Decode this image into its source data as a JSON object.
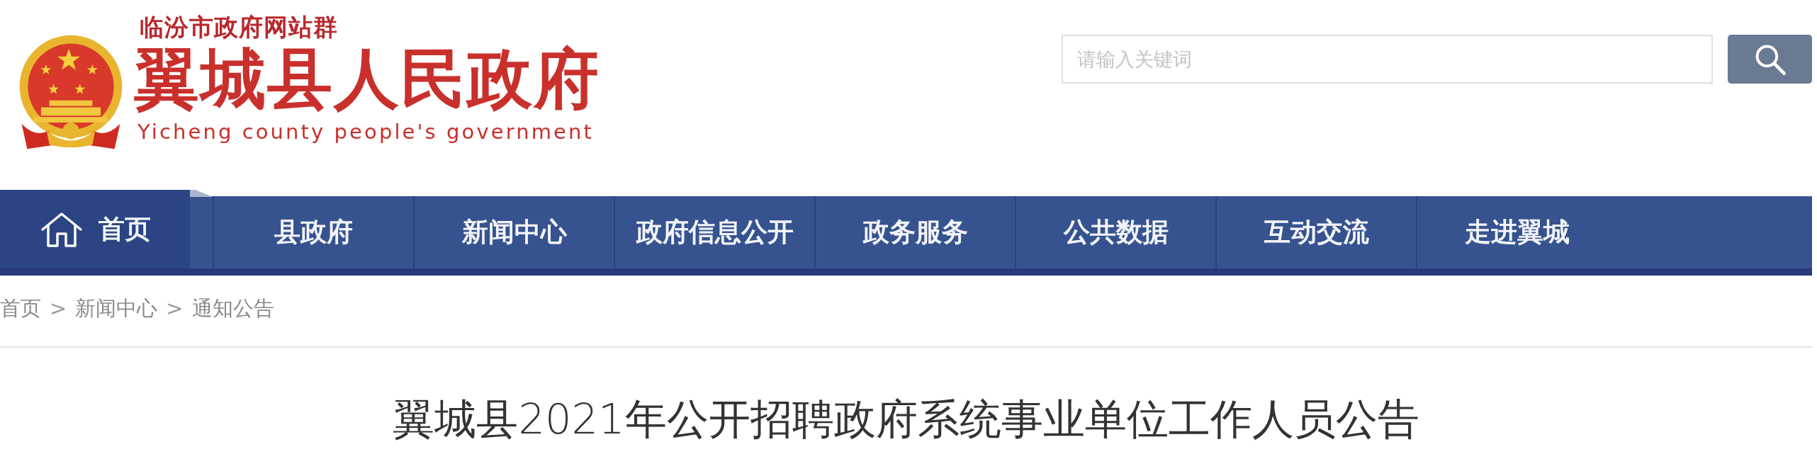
{
  "header": {
    "site_group": "临汾市政府网站群",
    "title": "翼城县人民政府",
    "subtitle": "Yicheng county people's government"
  },
  "search": {
    "placeholder": "请输入关键词"
  },
  "nav": [
    {
      "kind": "home",
      "label": "首页",
      "selected": true
    },
    {
      "kind": "link",
      "label": "县政府",
      "selected": false
    },
    {
      "kind": "link",
      "label": "新闻中心",
      "selected": false
    },
    {
      "kind": "link",
      "label": "政府信息公开",
      "selected": false
    },
    {
      "kind": "link",
      "label": "政务服务",
      "selected": false
    },
    {
      "kind": "link",
      "label": "公共数据",
      "selected": false
    },
    {
      "kind": "link",
      "label": "互动交流",
      "selected": false
    },
    {
      "kind": "link",
      "label": "走进翼城",
      "selected": false
    }
  ],
  "breadcrumb": [
    {
      "kind": "link",
      "text": "首页"
    },
    {
      "kind": "separator",
      "text": ">"
    },
    {
      "kind": "link",
      "text": "新闻中心"
    },
    {
      "kind": "separator",
      "text": ">"
    },
    {
      "kind": "link",
      "text": "通知公告"
    }
  ],
  "article": {
    "title": "翼城县2021年公开招聘政府系统事业单位工作人员公告"
  }
}
